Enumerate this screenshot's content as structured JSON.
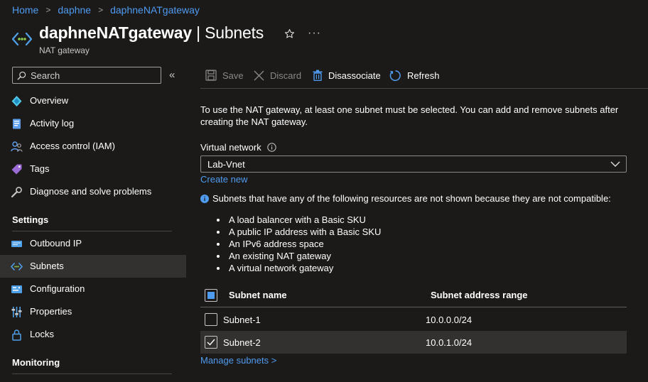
{
  "breadcrumb": {
    "items": [
      "Home",
      "daphne",
      "daphneNATgateway"
    ],
    "separator": ">"
  },
  "header": {
    "title_resource": "daphneNATgateway",
    "title_separator": "|",
    "title_page": "Subnets",
    "subtitle": "NAT gateway",
    "more_label": "···"
  },
  "sidebar": {
    "search_placeholder": "Search",
    "collapse_label": "«",
    "items": [
      {
        "label": "Overview",
        "icon": "overview-icon"
      },
      {
        "label": "Activity log",
        "icon": "activity-log-icon"
      },
      {
        "label": "Access control (IAM)",
        "icon": "iam-icon"
      },
      {
        "label": "Tags",
        "icon": "tag-icon"
      },
      {
        "label": "Diagnose and solve problems",
        "icon": "wrench-icon"
      }
    ],
    "settings_heading": "Settings",
    "settings_items": [
      {
        "label": "Outbound IP",
        "icon": "outbound-ip-icon"
      },
      {
        "label": "Subnets",
        "icon": "subnets-icon",
        "selected": true
      },
      {
        "label": "Configuration",
        "icon": "configuration-icon"
      },
      {
        "label": "Properties",
        "icon": "properties-icon"
      },
      {
        "label": "Locks",
        "icon": "lock-icon"
      }
    ],
    "monitoring_heading": "Monitoring"
  },
  "toolbar": {
    "save_label": "Save",
    "discard_label": "Discard",
    "disassociate_label": "Disassociate",
    "refresh_label": "Refresh"
  },
  "content": {
    "intro_text": "To use the NAT gateway, at least one subnet must be selected. You can add and remove subnets after creating the NAT gateway.",
    "vnet_label": "Virtual network",
    "vnet_value": "Lab-Vnet",
    "create_new_label": "Create new",
    "notice_text": "Subnets that have any of the following resources are not shown because they are not compatible:",
    "incompatible": [
      "A load balancer with a Basic SKU",
      "A public IP address with a Basic SKU",
      "An IPv6 address space",
      "An existing NAT gateway",
      "A virtual network gateway"
    ],
    "table": {
      "col_name": "Subnet name",
      "col_range": "Subnet address range",
      "rows": [
        {
          "name": "Subnet-1",
          "range": "10.0.0.0/24",
          "checked": false
        },
        {
          "name": "Subnet-2",
          "range": "10.0.1.0/24",
          "checked": true
        }
      ]
    },
    "manage_label": "Manage subnets >"
  },
  "colors": {
    "background": "#1b1a19",
    "link": "#4f9bf0",
    "selected_bg": "#323130",
    "accent_blue": "#4f9bf0"
  }
}
